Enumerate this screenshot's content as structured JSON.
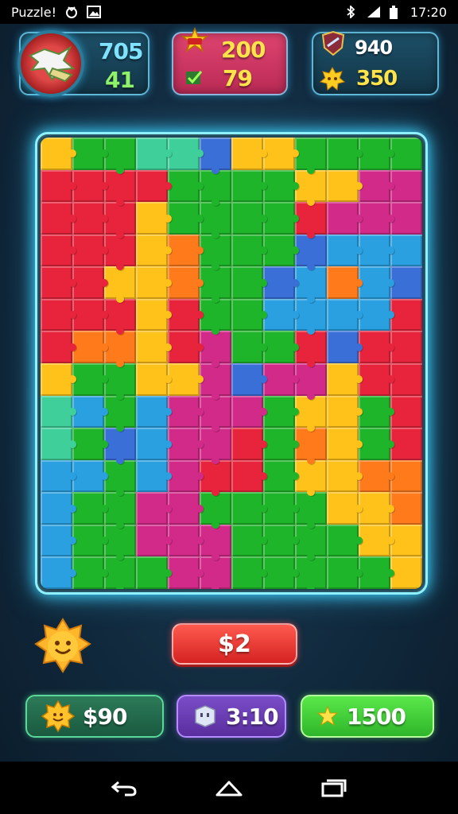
{
  "status_bar": {
    "app_label": "Puzzle!",
    "time": "17:20"
  },
  "hud": {
    "player": {
      "value_top": "705",
      "value_bottom": "41"
    },
    "center_panel": {
      "value_top": "200",
      "value_bottom": "79"
    },
    "right_panel": {
      "value_top": "940",
      "value_bottom": "350"
    }
  },
  "board": {
    "columns": 12,
    "rows": 14,
    "palette": {
      "R": "#e8243c",
      "G": "#1fb52a",
      "B": "#2aa0e0",
      "Y": "#ffc21a",
      "O": "#ff7a1a",
      "P": "#d22a88",
      "L": "#3b6fd8",
      "T": "#3fcf9a"
    },
    "layout": [
      "YGGTTLYYGGGG",
      "RRRRGGGGYYPP",
      "RRRYGGGGRPPP",
      "RRRYOGGGLBBB",
      "RRYYOGGLBOBL",
      "RRRYRGGBBBBR",
      "ROOYRPGGRLRR",
      "YGGYYPLPPYRR",
      "TBGBPPPGYYGR",
      "TGLBPPRGOYGR",
      "BBGBPRRGYYOO",
      "BGGPPGGGGYYO",
      "BGGPPPGGGGYY",
      "BGGGPPGGGGGY"
    ]
  },
  "controls": {
    "center_button": "$2",
    "bottom_left": "$90",
    "bottom_middle": "3:10",
    "bottom_right": "1500"
  }
}
